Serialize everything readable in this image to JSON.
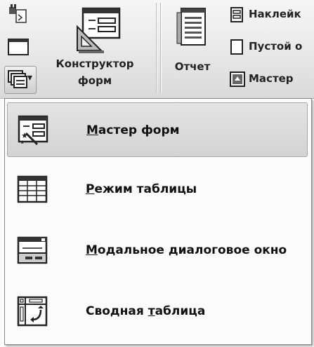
{
  "ribbon": {
    "form_designer": {
      "label_line1": "Конструктор",
      "label_line2": "форм"
    },
    "report": {
      "label": "Отчет"
    },
    "labels": {
      "label": "Наклейк"
    },
    "blank": {
      "label": "Пустой о"
    },
    "wizard": {
      "label": "Мастер"
    },
    "more_forms_caret": "▾"
  },
  "menu": {
    "items": [
      {
        "id": "form-wizard",
        "before": "",
        "accel": "М",
        "after": "астер форм",
        "highlighted": true,
        "icon": "form-wizard-icon"
      },
      {
        "id": "datasheet",
        "before": "",
        "accel": "Р",
        "after": "ежим таблицы",
        "highlighted": false,
        "icon": "datasheet-icon"
      },
      {
        "id": "modal-dialog",
        "before": "",
        "accel": "М",
        "after": "одальное диалоговое окно",
        "highlighted": false,
        "icon": "modal-dialog-icon"
      },
      {
        "id": "pivot-table",
        "before": "Сводная ",
        "accel": "т",
        "after": "аблица",
        "highlighted": false,
        "icon": "pivot-table-icon"
      }
    ]
  },
  "colors": {
    "highlight": "#d8d8d8",
    "menu_border": "#8a8a8a",
    "ribbon_bg": "#e6e6e6"
  }
}
